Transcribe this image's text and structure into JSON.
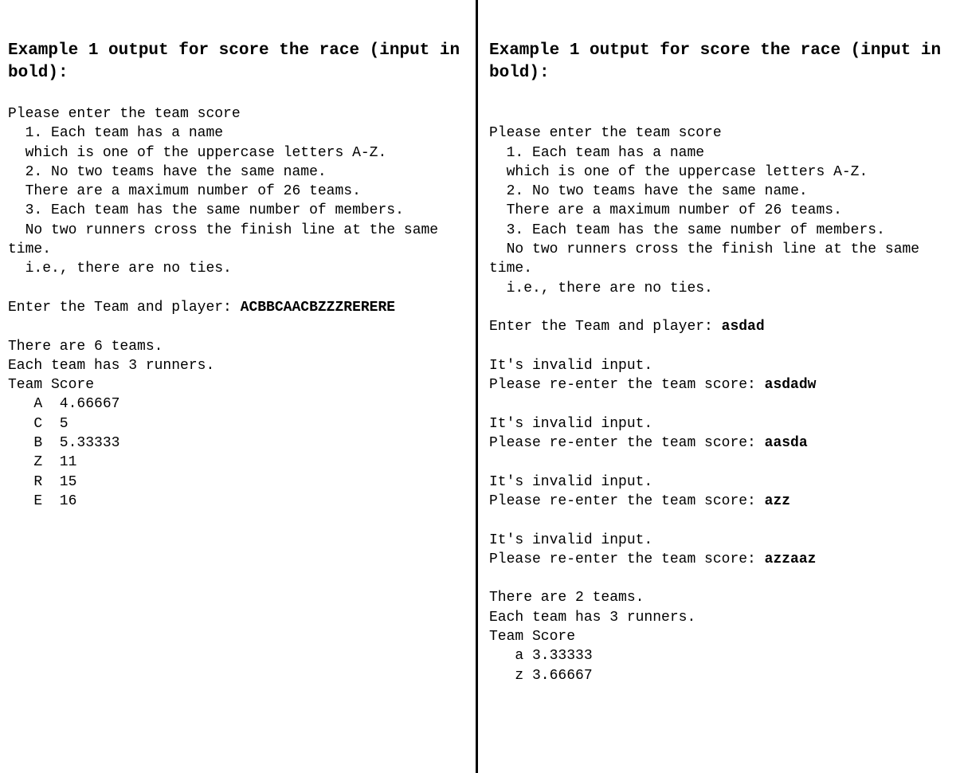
{
  "left": {
    "heading": "Example 1 output for score the race (input in bold):",
    "intro": "Please enter the team score\n  1. Each team has a name\n  which is one of the uppercase letters A-Z.\n  2. No two teams have the same name.\n  There are a maximum number of 26 teams.\n  3. Each team has the same number of members.\n  No two runners cross the finish line at the same time.\n  i.e., there are no ties.",
    "prompt1_label": "Enter the Team and player: ",
    "prompt1_input": "ACBBCAACBZZZRERERE",
    "result": "There are 6 teams.\nEach team has 3 runners.\nTeam Score\n   A  4.66667\n   C  5\n   B  5.33333\n   Z  11\n   R  15\n   E  16"
  },
  "right": {
    "heading": "Example 1 output for score the race (input in bold):",
    "intro": "Please enter the team score\n  1. Each team has a name\n  which is one of the uppercase letters A-Z.\n  2. No two teams have the same name.\n  There are a maximum number of 26 teams.\n  3. Each team has the same number of members.\n  No two runners cross the finish line at the same time.\n  i.e., there are no ties.",
    "prompt1_label": "Enter the Team and player: ",
    "prompt1_input": "asdad",
    "attempts": [
      {
        "msg": "It's invalid input.\nPlease re-enter the team score: ",
        "input": "asdadw"
      },
      {
        "msg": "It's invalid input.\nPlease re-enter the team score: ",
        "input": "aasda"
      },
      {
        "msg": "It's invalid input.\nPlease re-enter the team score: ",
        "input": "azz"
      },
      {
        "msg": "It's invalid input.\nPlease re-enter the team score: ",
        "input": "azzaaz"
      }
    ],
    "result": "There are 2 teams.\nEach team has 3 runners.\nTeam Score\n   a 3.33333\n   z 3.66667"
  }
}
